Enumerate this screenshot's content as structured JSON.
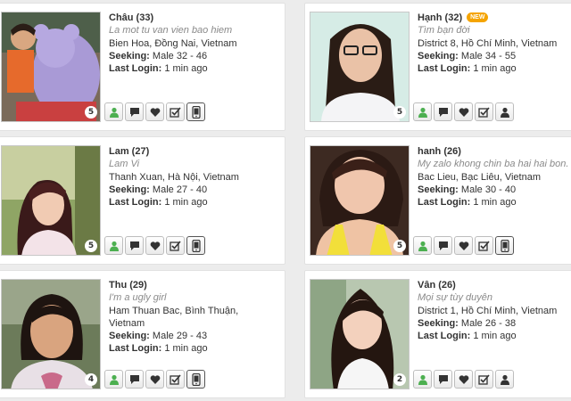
{
  "colors": {
    "online_green": "#4caf50",
    "icon_dark": "#333333",
    "new_badge": "#f5a400",
    "tagline": "#8a8a8a"
  },
  "action_icons": [
    "profile-icon",
    "message-icon",
    "heart-icon",
    "checklist-icon",
    "mobile-icon"
  ],
  "members": [
    {
      "name_age": "Châu (33)",
      "is_new": false,
      "tagline": "La mot tu van vien bao hiem",
      "location": "Bien Hoa, Đồng Nai, Vietnam",
      "seeking_label": "Seeking:",
      "seeking": "Male 32 - 46",
      "login_label": "Last Login:",
      "last_login": "1 min ago",
      "photo_count": "5",
      "last_action_icon": "mobile-icon"
    },
    {
      "name_age": "Hạnh (32)",
      "is_new": true,
      "new_label": "NEW",
      "tagline": "Tìm bạn đời",
      "location": "District 8, Hồ Chí Minh, Vietnam",
      "seeking_label": "Seeking:",
      "seeking": "Male 34 - 55",
      "login_label": "Last Login:",
      "last_login": "1 min ago",
      "photo_count": "5",
      "last_action_icon": "user-dark-icon"
    },
    {
      "name_age": "Lam (27)",
      "is_new": false,
      "tagline": "Lam Vi",
      "location": "Thanh Xuan, Hà Nội, Vietnam",
      "seeking_label": "Seeking:",
      "seeking": "Male 27 - 40",
      "login_label": "Last Login:",
      "last_login": "1 min ago",
      "photo_count": "5",
      "last_action_icon": "mobile-icon"
    },
    {
      "name_age": "hanh (26)",
      "is_new": false,
      "tagline": "My zalo khong chin ba hai hai bon.",
      "location": "Bac Lieu, Bạc Liêu, Vietnam",
      "seeking_label": "Seeking:",
      "seeking": "Male 30 - 40",
      "login_label": "Last Login:",
      "last_login": "1 min ago",
      "photo_count": "5",
      "last_action_icon": "mobile-icon"
    },
    {
      "name_age": "Thu (29)",
      "is_new": false,
      "tagline": "I'm a ugly girl",
      "location": "Ham Thuan Bac, Bình Thuận, Vietnam",
      "seeking_label": "Seeking:",
      "seeking": "Male 29 - 43",
      "login_label": "Last Login:",
      "last_login": "1 min ago",
      "photo_count": "4",
      "last_action_icon": "mobile-icon"
    },
    {
      "name_age": "Vân (26)",
      "is_new": false,
      "tagline": "Mọi sự tùy duyên",
      "location": "District 1, Hồ Chí Minh, Vietnam",
      "seeking_label": "Seeking:",
      "seeking": "Male 26 - 38",
      "login_label": "Last Login:",
      "last_login": "1 min ago",
      "photo_count": "2",
      "last_action_icon": "user-dark-icon"
    }
  ]
}
